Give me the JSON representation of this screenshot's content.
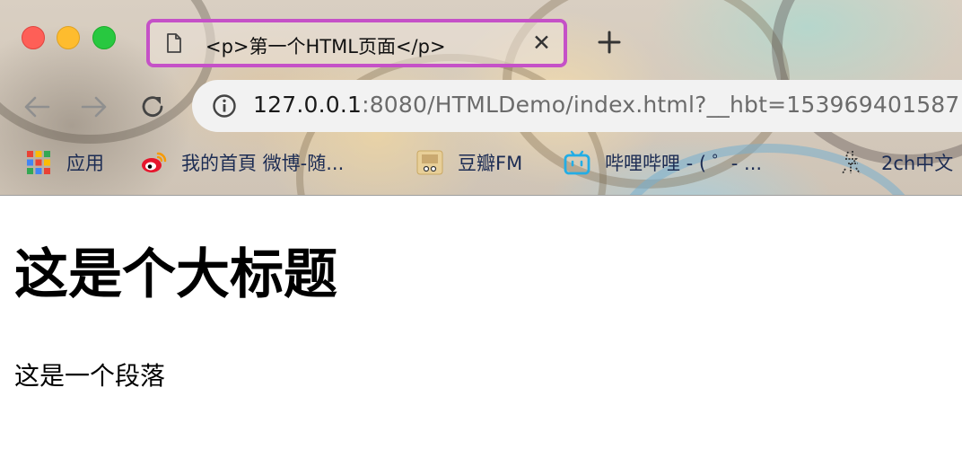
{
  "tab": {
    "title": "<p>第一个HTML页面</p>",
    "close_symbol": "✕",
    "new_tab_symbol": "+"
  },
  "address_bar": {
    "url_host": "127.0.0.1",
    "url_rest": ":8080/HTMLDemo/index.html?__hbt=153969401587"
  },
  "bookmarks": [
    {
      "label": "应用",
      "icon": "apps-grid-icon"
    },
    {
      "label": "我的首頁 微博-随...",
      "icon": "weibo-icon"
    },
    {
      "label": "豆瓣FM",
      "icon": "douban-fm-icon"
    },
    {
      "label": "哔哩哔哩 - ( ゜- ...",
      "icon": "bilibili-icon"
    },
    {
      "label": "2ch中文",
      "icon": "2ch-icon"
    }
  ],
  "page": {
    "heading": "这是个大标题",
    "paragraph": "这是一个段落"
  },
  "colors": {
    "tab_highlight": "#c551c7",
    "close": "#fe5f57",
    "minimize": "#febc2e",
    "maximize": "#28c840",
    "bookmark_text": "#1c2c53"
  }
}
